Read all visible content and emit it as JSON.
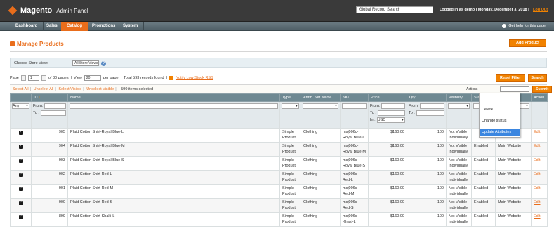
{
  "header": {
    "logo_title": "Magento",
    "logo_subtitle": "Admin Panel",
    "global_search_placeholder": "Global Record Search",
    "logged_in": "Logged in as demo  |  Monday, December 3, 2018  |",
    "logout": "Log Out"
  },
  "nav": {
    "items": [
      "Dashboard",
      "Sales",
      "Catalog",
      "Promotions",
      "System"
    ],
    "active": "Catalog",
    "help": "Get help for this page"
  },
  "page": {
    "title": "Manage Products",
    "add_button": "Add Product"
  },
  "store_switcher": {
    "label": "Choose Store View:",
    "value": "All Store Views"
  },
  "pager": {
    "page_label": "Page",
    "page_value": "1",
    "of_pages": "of 30 pages",
    "view_label": "View",
    "view_value": "20",
    "per_page": "per page",
    "total": "Total 593 records found",
    "notify": "Notify Low Stock RSS",
    "reset_filter": "Reset Filter",
    "search": "Search"
  },
  "massaction": {
    "select_all": "Select All",
    "unselect_all": "Unselect All",
    "select_visible": "Select Visible",
    "unselect_visible": "Unselect Visible",
    "selected": "590 items selected",
    "actions_label": "Actions",
    "submit": "Submit"
  },
  "dropdown": {
    "items": [
      "Delete",
      "Change status",
      "Update Attributes"
    ],
    "highlighted": "Update Attributes"
  },
  "grid": {
    "columns": [
      "",
      "ID",
      "Name",
      "Type",
      "Attrib. Set Name",
      "SKU",
      "Price",
      "Qty",
      "Visibility",
      "Status",
      "Websites",
      "Action"
    ],
    "filter": {
      "any": "Any",
      "from": "From:",
      "to": "To :",
      "in": "In :",
      "currency": "USD"
    },
    "rows": [
      {
        "id": "905",
        "name": "Plaid Cotton Shirt-Royal Blue-L",
        "type": "Simple Product",
        "set": "Clothing",
        "sku": "msj006c-Royal Blue-L",
        "price": "$160.00",
        "qty": "100",
        "visibility": "Not Visible Individually",
        "status": "",
        "websites": "",
        "action": "Edit"
      },
      {
        "id": "904",
        "name": "Plaid Cotton Shirt-Royal Blue-M",
        "type": "Simple Product",
        "set": "Clothing",
        "sku": "msj006c-Royal Blue-M",
        "price": "$160.00",
        "qty": "100",
        "visibility": "Not Visible Individually",
        "status": "Enabled",
        "websites": "Main Website",
        "action": "Edit"
      },
      {
        "id": "903",
        "name": "Plaid Cotton Shirt-Royal Blue-S",
        "type": "Simple Product",
        "set": "Clothing",
        "sku": "msj006c-Royal Blue-S",
        "price": "$160.00",
        "qty": "100",
        "visibility": "Not Visible Individually",
        "status": "Enabled",
        "websites": "Main Website",
        "action": "Edit"
      },
      {
        "id": "902",
        "name": "Plaid Cotton Shirt-Red-L",
        "type": "Simple Product",
        "set": "Clothing",
        "sku": "msj006c-Red-L",
        "price": "$160.00",
        "qty": "100",
        "visibility": "Not Visible Individually",
        "status": "Enabled",
        "websites": "Main Website",
        "action": "Edit"
      },
      {
        "id": "901",
        "name": "Plaid Cotton Shirt-Red-M",
        "type": "Simple Product",
        "set": "Clothing",
        "sku": "msj006c-Red-M",
        "price": "$160.00",
        "qty": "100",
        "visibility": "Not Visible Individually",
        "status": "Enabled",
        "websites": "Main Website",
        "action": "Edit"
      },
      {
        "id": "900",
        "name": "Plaid Cotton Shirt-Red-S",
        "type": "Simple Product",
        "set": "Clothing",
        "sku": "msj006c-Red-S",
        "price": "$160.00",
        "qty": "100",
        "visibility": "Not Visible Individually",
        "status": "Enabled",
        "websites": "Main Website",
        "action": "Edit"
      },
      {
        "id": "899",
        "name": "Plaid Cotton Shirt-Khaki-L",
        "type": "Simple Product",
        "set": "Clothing",
        "sku": "msj006c-Khaki-L",
        "price": "$160.00",
        "qty": "100",
        "visibility": "Not Visible Individually",
        "status": "Enabled",
        "websites": "Main Website",
        "action": "Edit"
      }
    ]
  },
  "colors": {
    "accent": "#e96d1b",
    "header": "#3a3a3a",
    "grid_header": "#6f8992",
    "dropdown_highlight": "#3b86e0"
  }
}
